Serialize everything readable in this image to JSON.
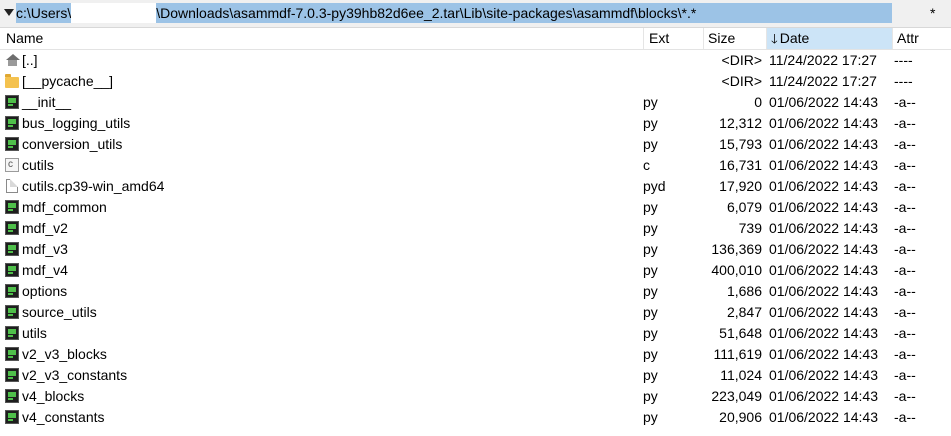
{
  "path": {
    "prefix": "c:\\Users\\",
    "suffix": "\\Downloads\\asammdf-7.0.3-py39hb82d6ee_2.tar\\Lib\\site-packages\\asammdf\\blocks\\*.*",
    "filter": "*"
  },
  "columns": {
    "name": "Name",
    "ext": "Ext",
    "size": "Size",
    "date": "Date",
    "attr": "Attr"
  },
  "sort": {
    "column": "date",
    "direction": "descending",
    "icon": "arrow-down-icon"
  },
  "rows": [
    {
      "name": "[..]",
      "ext": "",
      "size": "<DIR>",
      "date": "11/24/2022 17:27",
      "attr": "----",
      "icon": "up-dir"
    },
    {
      "name": "[__pycache__]",
      "ext": "",
      "size": "<DIR>",
      "date": "11/24/2022 17:27",
      "attr": "----",
      "icon": "folder"
    },
    {
      "name": "__init__",
      "ext": "py",
      "size": "0",
      "date": "01/06/2022 14:43",
      "attr": "-a--",
      "icon": "py"
    },
    {
      "name": "bus_logging_utils",
      "ext": "py",
      "size": "12,312",
      "date": "01/06/2022 14:43",
      "attr": "-a--",
      "icon": "py"
    },
    {
      "name": "conversion_utils",
      "ext": "py",
      "size": "15,793",
      "date": "01/06/2022 14:43",
      "attr": "-a--",
      "icon": "py"
    },
    {
      "name": "cutils",
      "ext": "c",
      "size": "16,731",
      "date": "01/06/2022 14:43",
      "attr": "-a--",
      "icon": "c"
    },
    {
      "name": "cutils.cp39-win_amd64",
      "ext": "pyd",
      "size": "17,920",
      "date": "01/06/2022 14:43",
      "attr": "-a--",
      "icon": "pyd"
    },
    {
      "name": "mdf_common",
      "ext": "py",
      "size": "6,079",
      "date": "01/06/2022 14:43",
      "attr": "-a--",
      "icon": "py"
    },
    {
      "name": "mdf_v2",
      "ext": "py",
      "size": "739",
      "date": "01/06/2022 14:43",
      "attr": "-a--",
      "icon": "py"
    },
    {
      "name": "mdf_v3",
      "ext": "py",
      "size": "136,369",
      "date": "01/06/2022 14:43",
      "attr": "-a--",
      "icon": "py"
    },
    {
      "name": "mdf_v4",
      "ext": "py",
      "size": "400,010",
      "date": "01/06/2022 14:43",
      "attr": "-a--",
      "icon": "py"
    },
    {
      "name": "options",
      "ext": "py",
      "size": "1,686",
      "date": "01/06/2022 14:43",
      "attr": "-a--",
      "icon": "py"
    },
    {
      "name": "source_utils",
      "ext": "py",
      "size": "2,847",
      "date": "01/06/2022 14:43",
      "attr": "-a--",
      "icon": "py"
    },
    {
      "name": "utils",
      "ext": "py",
      "size": "51,648",
      "date": "01/06/2022 14:43",
      "attr": "-a--",
      "icon": "py"
    },
    {
      "name": "v2_v3_blocks",
      "ext": "py",
      "size": "111,619",
      "date": "01/06/2022 14:43",
      "attr": "-a--",
      "icon": "py"
    },
    {
      "name": "v2_v3_constants",
      "ext": "py",
      "size": "11,024",
      "date": "01/06/2022 14:43",
      "attr": "-a--",
      "icon": "py"
    },
    {
      "name": "v4_blocks",
      "ext": "py",
      "size": "223,049",
      "date": "01/06/2022 14:43",
      "attr": "-a--",
      "icon": "py"
    },
    {
      "name": "v4_constants",
      "ext": "py",
      "size": "20,906",
      "date": "01/06/2022 14:43",
      "attr": "-a--",
      "icon": "py"
    }
  ]
}
